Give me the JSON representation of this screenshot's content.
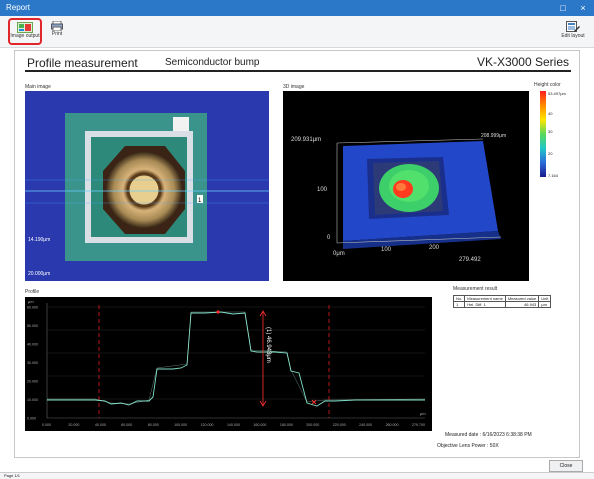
{
  "window": {
    "title": "Report",
    "minimize": "□",
    "close": "×"
  },
  "toolbar": {
    "image_output_label": "Image output",
    "print_label": "Print",
    "edit_layout_label": "Edit layout"
  },
  "report": {
    "title": "Profile measurement",
    "subtitle": "Semiconductor bump",
    "series": "VK-X3000 Series"
  },
  "main_image": {
    "label": "Main image",
    "scale_label_1": "14.190μm",
    "scale_label_2": "20.000μm",
    "line_marker": "1"
  },
  "image_3d": {
    "label": "3D image",
    "z_top": "209.931μm",
    "z_mid": "100",
    "z_zero": "0",
    "x_zero": "0μm",
    "x_100": "100",
    "x_200": "200",
    "x_end": "279.492",
    "y_end": "208.999μm"
  },
  "height_color": {
    "label": "Height color",
    "top": "53.497μm",
    "t40": "40",
    "t30": "30",
    "t20": "20",
    "bottom": "7.164"
  },
  "profile": {
    "label": "Profile",
    "unit_x": "μm",
    "unit_y": "μm",
    "measurement_label": "(1) 46.943μm",
    "y_ticks": [
      "60.000",
      "50.000",
      "40.000",
      "30.000",
      "20.000",
      "10.000",
      "0.000"
    ],
    "x_ticks": [
      "0.000",
      "20.000",
      "40.000",
      "60.000",
      "80.000",
      "100.000",
      "120.000",
      "140.000",
      "160.000",
      "180.000",
      "200.000",
      "220.000",
      "240.000",
      "260.000",
      "279.700"
    ]
  },
  "measurement_result": {
    "label": "Measurement result",
    "headers": [
      "No.",
      "Measurement name",
      "Measured value",
      "Unit"
    ],
    "rows": [
      [
        "1",
        "Hei. Diff. 1",
        "46.943",
        "μm"
      ]
    ]
  },
  "info": {
    "measured_date": "Measured date :  6/16/2023 6:38:38 PM",
    "objective_lens_power": "Objective Lens Power :  50X"
  },
  "close_label": "Close",
  "status": "Page 1/1"
}
